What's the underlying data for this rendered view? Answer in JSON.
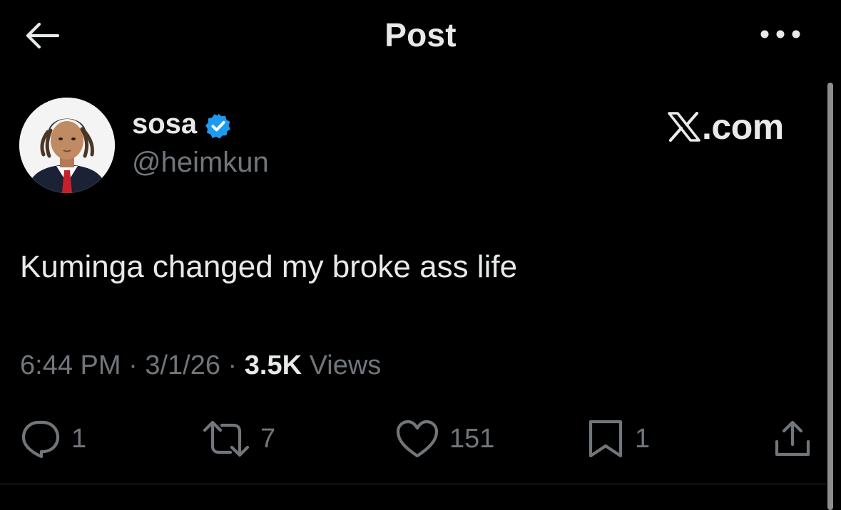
{
  "header": {
    "title": "Post",
    "back_icon": "arrow-left-icon",
    "more_icon": "more-horizontal-icon"
  },
  "author": {
    "display_name": "sosa",
    "handle": "@heimkun",
    "verified_icon": "verified-badge-icon",
    "verified_color": "#1d9bf0"
  },
  "watermark": {
    "suffix": ".com",
    "logo_icon": "x-logo-icon"
  },
  "post": {
    "text": "Kuminga changed my broke ass life"
  },
  "meta": {
    "time": "6:44 PM",
    "separator1": " · ",
    "date": "3/1/26",
    "separator2": " · ",
    "views_count": "3.5K",
    "views_label": " Views"
  },
  "actions": {
    "reply": {
      "icon": "reply-icon",
      "count": "1"
    },
    "repost": {
      "icon": "repost-icon",
      "count": "7"
    },
    "like": {
      "icon": "heart-icon",
      "count": "151"
    },
    "bookmark": {
      "icon": "bookmark-icon",
      "count": "1"
    },
    "share": {
      "icon": "share-icon"
    }
  },
  "colors": {
    "background": "#000000",
    "text_primary": "#e7e9ea",
    "text_secondary": "#71767b",
    "divider": "#2f3336"
  }
}
